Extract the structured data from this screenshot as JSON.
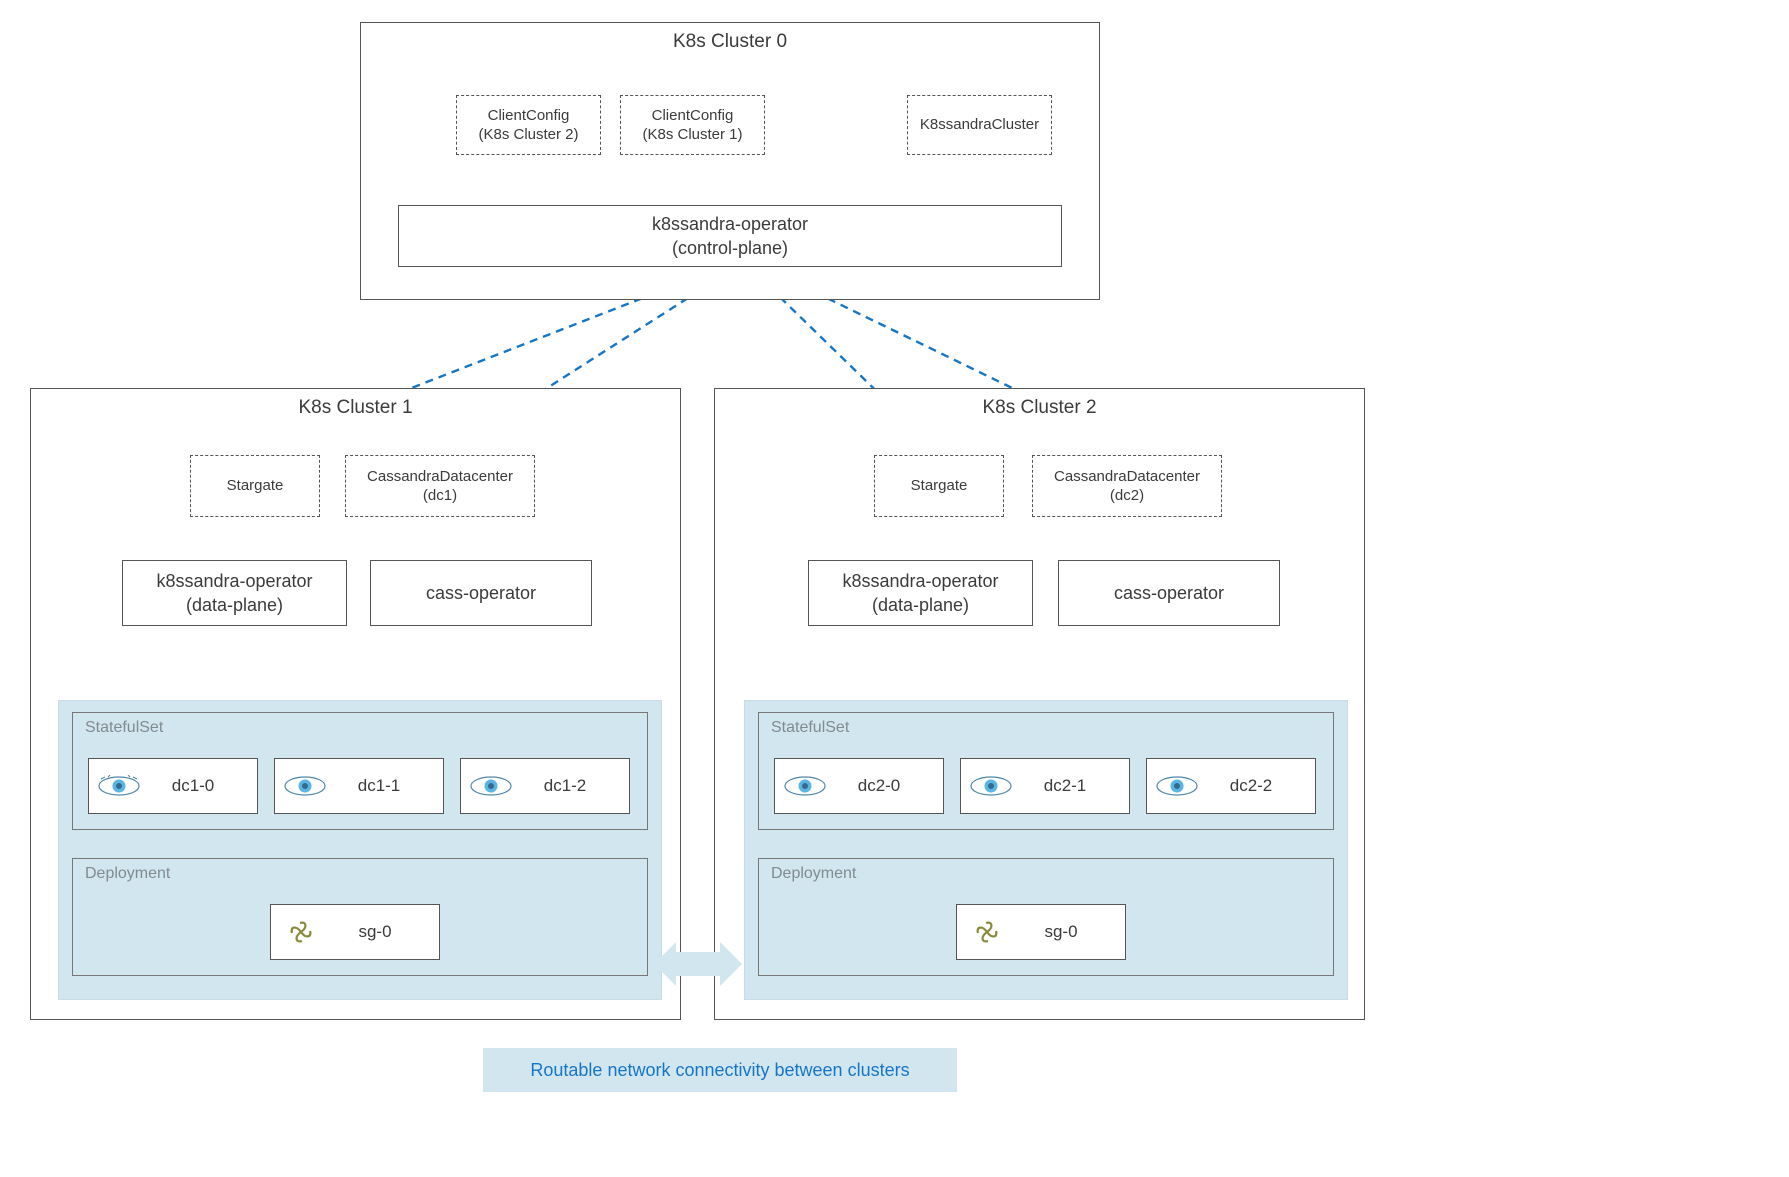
{
  "cluster0": {
    "title": "K8s Cluster 0",
    "clientConfig2": {
      "l1": "ClientConfig",
      "l2": "(K8s Cluster 2)"
    },
    "clientConfig1": {
      "l1": "ClientConfig",
      "l2": "(K8s Cluster 1)"
    },
    "k8ssandraCluster": "K8ssandraCluster",
    "operator": {
      "l1": "k8ssandra-operator",
      "l2": "(control-plane)"
    }
  },
  "cluster1": {
    "title": "K8s Cluster 1",
    "stargate": "Stargate",
    "cassDC": {
      "l1": "CassandraDatacenter",
      "l2": "(dc1)"
    },
    "dataPlane": {
      "l1": "k8ssandra-operator",
      "l2": "(data-plane)"
    },
    "cassOperator": "cass-operator",
    "statefulset": "StatefulSet",
    "deployment": "Deployment",
    "pods": [
      "dc1-0",
      "dc1-1",
      "dc1-2"
    ],
    "sg": "sg-0"
  },
  "cluster2": {
    "title": "K8s Cluster 2",
    "stargate": "Stargate",
    "cassDC": {
      "l1": "CassandraDatacenter",
      "l2": "(dc2)"
    },
    "dataPlane": {
      "l1": "k8ssandra-operator",
      "l2": "(data-plane)"
    },
    "cassOperator": "cass-operator",
    "statefulset": "StatefulSet",
    "deployment": "Deployment",
    "pods": [
      "dc2-0",
      "dc2-1",
      "dc2-2"
    ],
    "sg": "sg-0"
  },
  "banner": "Routable network connectivity between clusters",
  "colors": {
    "blue": "#1676c6",
    "lightBlue": "#d2e6ef"
  }
}
